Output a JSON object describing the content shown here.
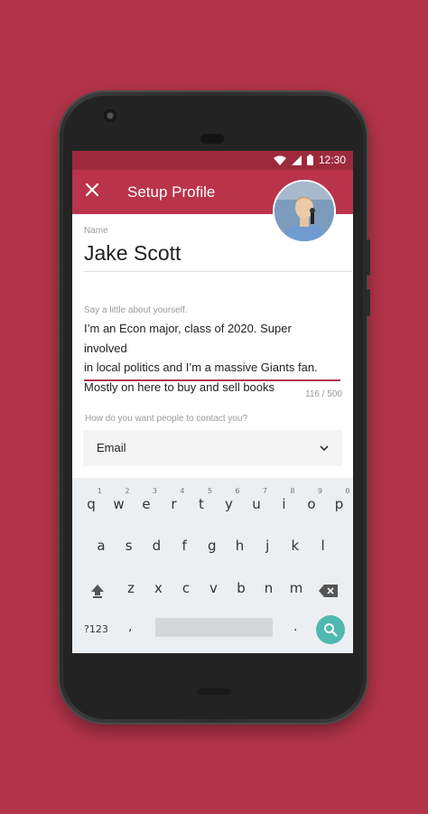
{
  "status": {
    "time": "12:30"
  },
  "appbar": {
    "title": "Setup Profile"
  },
  "form": {
    "name_label": "Name",
    "name_value": "Jake Scott",
    "about_label": "Say a little about yourself.",
    "about_lines": [
      "I’m an Econ major, class of 2020. Super involved",
      "in local politics and I’m a massive Giants fan.",
      "Mostly on here to buy and sell books"
    ],
    "about_counter": "116 / 500",
    "contact_label": "How do you want people to contact you?",
    "contact_value": "Email"
  },
  "keyboard": {
    "row1": [
      {
        "k": "q",
        "h": "1"
      },
      {
        "k": "w",
        "h": "2"
      },
      {
        "k": "e",
        "h": "3"
      },
      {
        "k": "r",
        "h": "4"
      },
      {
        "k": "t",
        "h": "5"
      },
      {
        "k": "y",
        "h": "6"
      },
      {
        "k": "u",
        "h": "7"
      },
      {
        "k": "i",
        "h": "8"
      },
      {
        "k": "o",
        "h": "9"
      },
      {
        "k": "p",
        "h": "0"
      }
    ],
    "row2": [
      "a",
      "s",
      "d",
      "f",
      "g",
      "h",
      "j",
      "k",
      "l"
    ],
    "row3": [
      "z",
      "x",
      "c",
      "v",
      "b",
      "n",
      "m"
    ],
    "symbols_label": "?123",
    "comma": ",",
    "period": "."
  },
  "colors": {
    "background": "#b3344a",
    "appbar": "#b9344b",
    "statusbar": "#9c2a3c",
    "accent_underline": "#b3344a",
    "search_key": "#4fb8b0"
  },
  "icons": [
    "close-icon",
    "wifi-icon",
    "signal-icon",
    "battery-icon",
    "chevron-down-icon",
    "shift-icon",
    "backspace-icon",
    "search-icon"
  ]
}
